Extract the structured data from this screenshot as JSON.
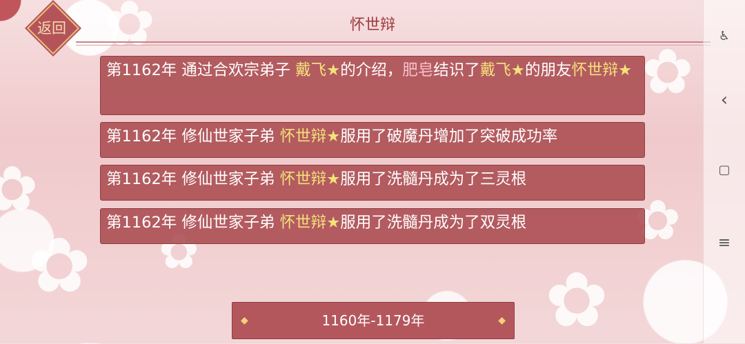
{
  "header": {
    "back_label": "返回",
    "title": "怀世辩"
  },
  "entries": [
    {
      "segments": [
        {
          "text": "第1162年 通过合欢宗弟子 ",
          "style": "plain"
        },
        {
          "text": "戴飞★",
          "style": "name"
        },
        {
          "text": "的介绍，",
          "style": "plain"
        },
        {
          "text": "肥皂",
          "style": "name2"
        },
        {
          "text": "结识了",
          "style": "plain"
        },
        {
          "text": "戴飞★",
          "style": "name"
        },
        {
          "text": "的朋友",
          "style": "plain"
        },
        {
          "text": "怀世辩★",
          "style": "name"
        }
      ]
    },
    {
      "segments": [
        {
          "text": "第1162年 修仙世家子弟 ",
          "style": "plain"
        },
        {
          "text": "怀世辩★",
          "style": "name"
        },
        {
          "text": "服用了破魔丹增加了突破成功率",
          "style": "plain"
        }
      ]
    },
    {
      "segments": [
        {
          "text": "第1162年 修仙世家子弟 ",
          "style": "plain"
        },
        {
          "text": "怀世辩★",
          "style": "name"
        },
        {
          "text": "服用了洗髓丹成为了三灵根",
          "style": "plain"
        }
      ]
    },
    {
      "segments": [
        {
          "text": "第1162年 修仙世家子弟 ",
          "style": "plain"
        },
        {
          "text": "怀世辩★",
          "style": "name"
        },
        {
          "text": "服用了洗髓丹成为了双灵根",
          "style": "plain"
        }
      ]
    }
  ],
  "range_label": "1160年-1179年",
  "system_bar": {
    "icons": [
      "accessibility-icon",
      "back-nav-icon",
      "recents-icon",
      "menu-icon"
    ],
    "glyphs": {
      "accessibility": "♿",
      "back": "‹",
      "recents": "▢",
      "menu": "≡"
    }
  },
  "colors": {
    "entry_bg": "#aa4b50",
    "highlight_name": "#f4e27a",
    "highlight_other": "#f7c0c8",
    "title": "#9b3b40"
  }
}
